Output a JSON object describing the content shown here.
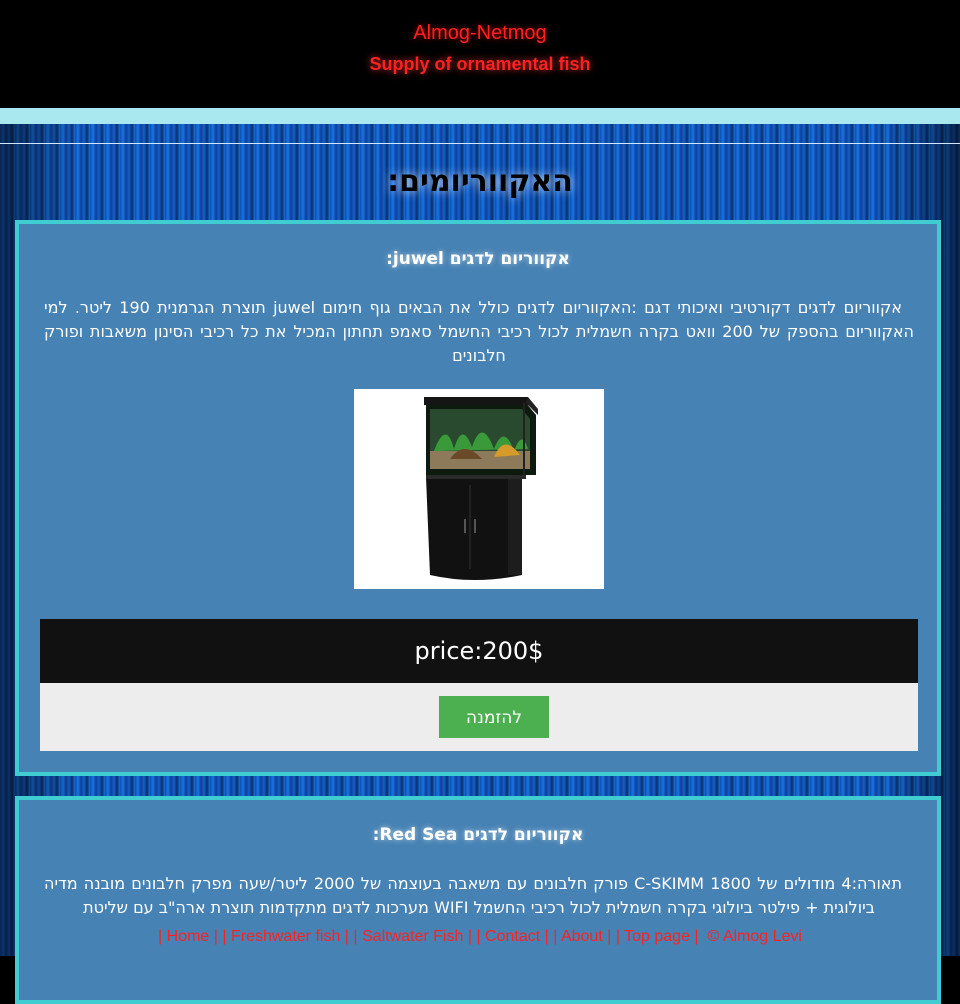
{
  "header": {
    "title": "Almog-Netmog",
    "subtitle": "Supply of ornamental fish"
  },
  "page": {
    "heading": "האקווריומים:"
  },
  "products": [
    {
      "title": "אקווריום לדגים juwel:",
      "description": "אקווריום לדגים דקורטיבי ואיכותי דגם :האקווריום לדגים כולל את הבאים גוף חימום juwel תוצרת הגרמנית 190 ליטר. למי האקווריום בהספק של 200 וואט בקרה חשמלית לכול רכיבי החשמל סאמפ תחתון המכיל את כל רכיבי הסינון משאבות ופורק חלבונים",
      "image_alt": "juwel aquarium",
      "price": "price:200$",
      "order_label": "להזמנה"
    },
    {
      "title": "אקווריום לדגים Red Sea:",
      "description": "תאורה:4 מודולים של C-SKIMM 1800 פורק חלבונים עם משאבה בעוצמה של 2000 ליטר/שעה מפרק חלבונים מובנה מדיה ביולוגית + פילטר ביולוגי בקרה חשמלית לכול רכיבי החשמל WIFI מערכות לדגים מתקדמות תוצרת ארה\"ב עם שליטת"
    }
  ],
  "footer": {
    "links": [
      {
        "label": "| Home |"
      },
      {
        "label": "| Freshwater fish |"
      },
      {
        "label": "| Saltwater Fish |"
      },
      {
        "label": "| Contact |"
      },
      {
        "label": "| About |"
      },
      {
        "label": "| Top page |"
      }
    ],
    "copyright": "© Almog Levi"
  },
  "colors": {
    "accent_red": "#ff2020",
    "card_bg": "#4682b4",
    "card_border": "#3fcdd2",
    "order_button": "#4caf50"
  }
}
